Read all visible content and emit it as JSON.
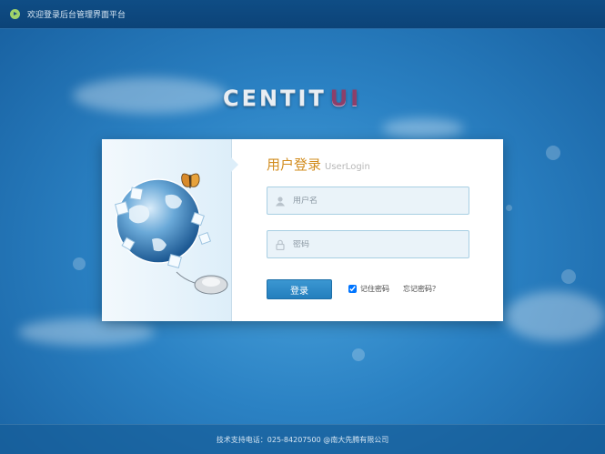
{
  "topbar": {
    "welcome_text": "欢迎登录后台管理界面平台"
  },
  "logo": {
    "part1": "CENTIT",
    "part2": "UI"
  },
  "login": {
    "title_cn": "用户登录",
    "title_en": "UserLogin",
    "username_placeholder": "用户名",
    "password_placeholder": "密码",
    "login_button": "登录",
    "remember_label": "记住密码",
    "remember_checked": true,
    "forgot_link": "忘记密码？"
  },
  "footer": {
    "text": "技术支持电话：025-84207500 @南大先腾有限公司"
  },
  "colors": {
    "accent": "#2b88c8",
    "title": "#d28c1e",
    "logo_ui": "#8c3f6a"
  },
  "icons": [
    "play-icon",
    "user-icon",
    "lock-icon",
    "globe-illustration",
    "butterfly-icon",
    "mouse-icon"
  ]
}
